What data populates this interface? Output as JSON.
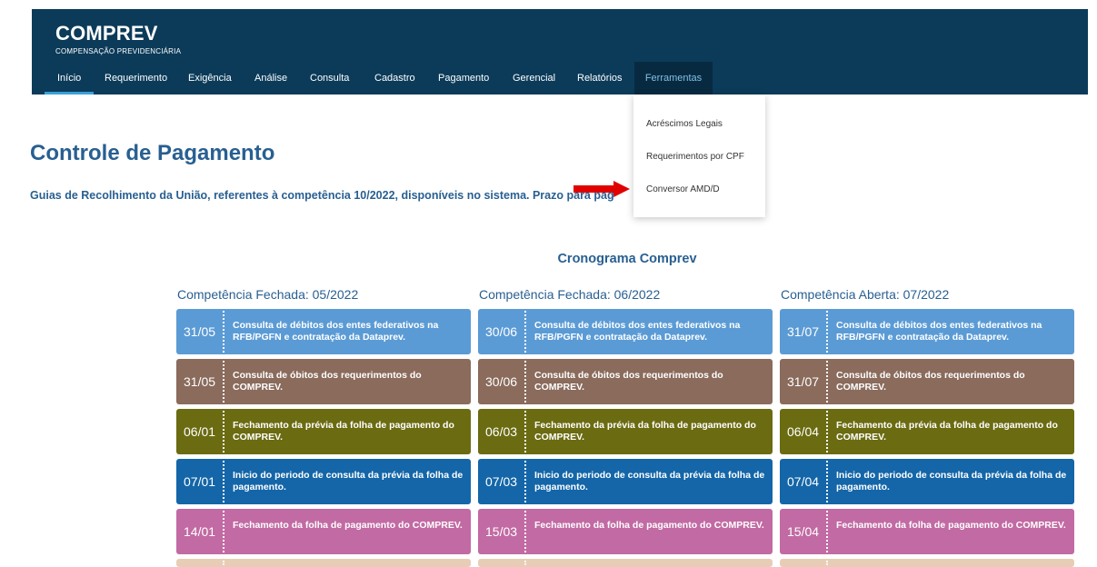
{
  "header": {
    "brand_title": "COMPREV",
    "brand_subtitle": "COMPENSAÇÃO PREVIDENCIÁRIA",
    "nav": [
      "Início",
      "Requerimento",
      "Exigência",
      "Análise",
      "Consulta",
      "Cadastro",
      "Pagamento",
      "Gerencial",
      "Relatórios",
      "Ferramentas"
    ],
    "active_item": "Início",
    "open_menu": "Ferramentas"
  },
  "dropdown": {
    "items": [
      "Acréscimos Legais",
      "Requerimentos por CPF",
      "Conversor AMD/D"
    ]
  },
  "page": {
    "title": "Controle de Pagamento",
    "notice": "Guias de Recolhimento da União, referentes à competência 10/2022, disponíveis no sistema. Prazo para pag"
  },
  "schedule": {
    "title": "Cronograma Comprev",
    "columns": [
      {
        "header": "Competência Fechada: 05/2022",
        "rows": [
          {
            "date": "31/05",
            "text": "Consulta de débitos dos entes federativos na RFB/PGFN e contratação da Dataprev."
          },
          {
            "date": "31/05",
            "text": "Consulta de óbitos dos requerimentos do COMPREV."
          },
          {
            "date": "06/01",
            "text": "Fechamento da prévia da folha de pagamento do COMPREV."
          },
          {
            "date": "07/01",
            "text": "Inicio do periodo de consulta da prévia da folha de pagamento."
          },
          {
            "date": "14/01",
            "text": "Fechamento da folha de pagamento do COMPREV."
          }
        ]
      },
      {
        "header": "Competência Fechada: 06/2022",
        "rows": [
          {
            "date": "30/06",
            "text": "Consulta de débitos dos entes federativos na RFB/PGFN e contratação da Dataprev."
          },
          {
            "date": "30/06",
            "text": "Consulta de óbitos dos requerimentos do COMPREV."
          },
          {
            "date": "06/03",
            "text": "Fechamento da prévia da folha de pagamento do COMPREV."
          },
          {
            "date": "07/03",
            "text": "Inicio do periodo de consulta da prévia da folha de pagamento."
          },
          {
            "date": "15/03",
            "text": "Fechamento da folha de pagamento do COMPREV."
          }
        ]
      },
      {
        "header": "Competência Aberta: 07/2022",
        "rows": [
          {
            "date": "31/07",
            "text": "Consulta de débitos dos entes federativos na RFB/PGFN e contratação da Dataprev."
          },
          {
            "date": "31/07",
            "text": "Consulta de óbitos dos requerimentos do COMPREV."
          },
          {
            "date": "06/04",
            "text": "Fechamento da prévia da folha de pagamento do COMPREV."
          },
          {
            "date": "07/04",
            "text": "Inicio do periodo de consulta da prévia da folha de pagamento."
          },
          {
            "date": "15/04",
            "text": "Fechamento da folha de pagamento do COMPREV."
          }
        ]
      }
    ]
  },
  "colors": {
    "header_bg": "#0b3b59",
    "title_blue": "#285f91",
    "active_underline": "#3aa0d8",
    "arrow_red": "#e00000",
    "row_colors": [
      "#5b9bd5",
      "#8a6b5c",
      "#6b6b12",
      "#1466a8",
      "#c26aa3",
      "#e8cdb6"
    ]
  }
}
